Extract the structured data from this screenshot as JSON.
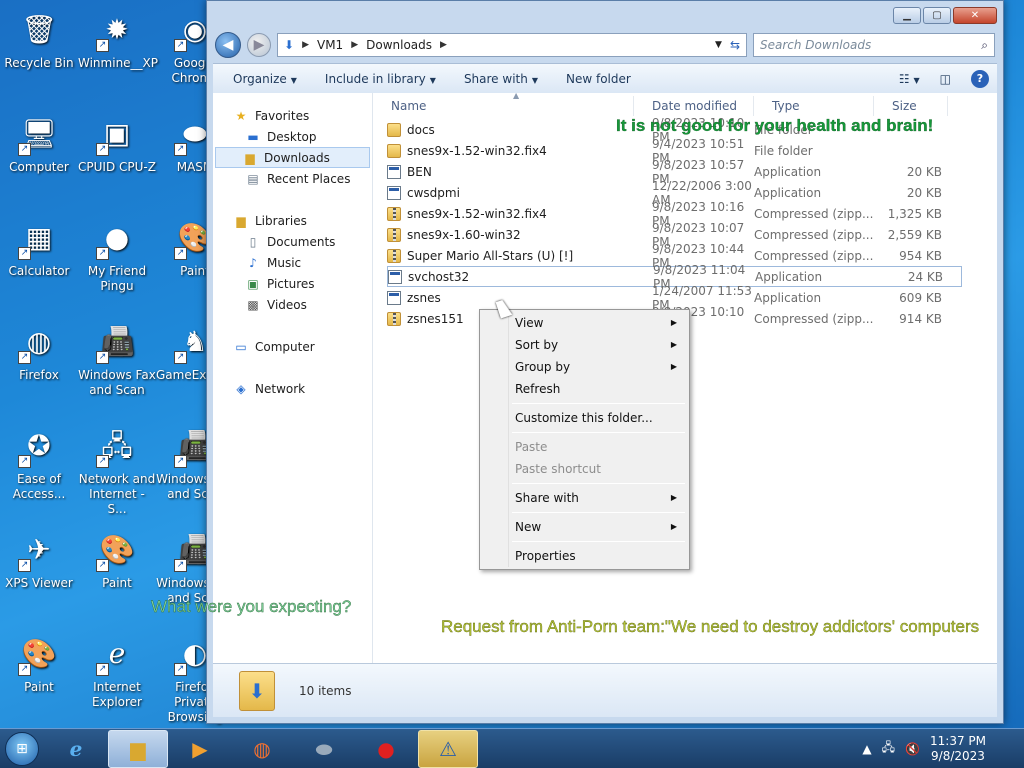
{
  "desktop": {
    "icons": [
      {
        "label": "Recycle Bin",
        "glyph": "🗑"
      },
      {
        "label": "Winmine__XP",
        "glyph": "✹"
      },
      {
        "label": "Google Chrome",
        "glyph": "◉"
      },
      {
        "label": "Computer",
        "glyph": "🖥"
      },
      {
        "label": "CPUID CPU-Z",
        "glyph": "▣"
      },
      {
        "label": "MASM",
        "glyph": "⬬"
      },
      {
        "label": "Calculator",
        "glyph": "▦"
      },
      {
        "label": "My Friend Pingu",
        "glyph": "●"
      },
      {
        "label": "Paint",
        "glyph": "🎨"
      },
      {
        "label": "Firefox",
        "glyph": "◍"
      },
      {
        "label": "Windows Fax and Scan",
        "glyph": "📠"
      },
      {
        "label": "GameExplorer",
        "glyph": "♞"
      },
      {
        "label": "Ease of Access...",
        "glyph": "✪"
      },
      {
        "label": "Network and Internet - S...",
        "glyph": "🖧"
      },
      {
        "label": "Windows Fax and Scan",
        "glyph": "📠"
      },
      {
        "label": "XPS Viewer",
        "glyph": "✈"
      },
      {
        "label": "Paint",
        "glyph": "🎨"
      },
      {
        "label": "Windows Fax and Scan",
        "glyph": "📠"
      },
      {
        "label": "Paint",
        "glyph": "🎨"
      },
      {
        "label": "Internet Explorer",
        "glyph": "ℯ"
      },
      {
        "label": "Firefox Private Browsing",
        "glyph": "◐"
      }
    ]
  },
  "window": {
    "controls": {
      "minimize": "▁",
      "maximize": "▢",
      "close": "✕"
    },
    "address": {
      "root": "VM1",
      "folder": "Downloads"
    },
    "search_placeholder": "Search Downloads",
    "toolbar": {
      "organize": "Organize",
      "include": "Include in library",
      "share": "Share with",
      "new_folder": "New folder",
      "help": "?"
    },
    "nav": {
      "favorites": "Favorites",
      "desktop": "Desktop",
      "downloads": "Downloads",
      "recent": "Recent Places",
      "libraries": "Libraries",
      "documents": "Documents",
      "music": "Music",
      "pictures": "Pictures",
      "videos": "Videos",
      "computer": "Computer",
      "network": "Network"
    },
    "columns": {
      "name": "Name",
      "date": "Date modified",
      "type": "Type",
      "size": "Size"
    },
    "files": [
      {
        "name": "docs",
        "date": "9/8/2023 10:10 PM",
        "type": "File folder",
        "size": "",
        "kind": "folder"
      },
      {
        "name": "snes9x-1.52-win32.fix4",
        "date": "9/4/2023 10:51 PM",
        "type": "File folder",
        "size": "",
        "kind": "folder"
      },
      {
        "name": "BEN",
        "date": "9/8/2023 10:57 PM",
        "type": "Application",
        "size": "20 KB",
        "kind": "app"
      },
      {
        "name": "cwsdpmi",
        "date": "12/22/2006 3:00 AM",
        "type": "Application",
        "size": "20 KB",
        "kind": "app"
      },
      {
        "name": "snes9x-1.52-win32.fix4",
        "date": "9/8/2023 10:16 PM",
        "type": "Compressed (zipp...",
        "size": "1,325 KB",
        "kind": "zip"
      },
      {
        "name": "snes9x-1.60-win32",
        "date": "9/8/2023 10:07 PM",
        "type": "Compressed (zipp...",
        "size": "2,559 KB",
        "kind": "zip"
      },
      {
        "name": "Super Mario All-Stars (U) [!]",
        "date": "9/8/2023 10:44 PM",
        "type": "Compressed (zipp...",
        "size": "954 KB",
        "kind": "zip"
      },
      {
        "name": "svchost32",
        "date": "9/8/2023 11:04 PM",
        "type": "Application",
        "size": "24 KB",
        "kind": "app"
      },
      {
        "name": "zsnes",
        "date": "1/24/2007 11:53 PM",
        "type": "Application",
        "size": "609 KB",
        "kind": "app"
      },
      {
        "name": "zsnes151",
        "date": "9/8/2023 10:10 PM",
        "type": "Compressed (zipp...",
        "size": "914 KB",
        "kind": "zip"
      }
    ],
    "status": "10 items"
  },
  "context_menu": {
    "view": "View",
    "sort_by": "Sort by",
    "group_by": "Group by",
    "refresh": "Refresh",
    "customize": "Customize this folder...",
    "paste": "Paste",
    "paste_shortcut": "Paste shortcut",
    "share_with": "Share with",
    "new": "New",
    "properties": "Properties"
  },
  "overlay": {
    "msg1": "It is not good for your health and brain!",
    "msg2": "What were you expecting?",
    "msg3": "Request from Anti-Porn team:\"We need to destroy addictors' computers"
  },
  "taskbar": {
    "time": "11:37 PM",
    "date": "9/8/2023"
  }
}
